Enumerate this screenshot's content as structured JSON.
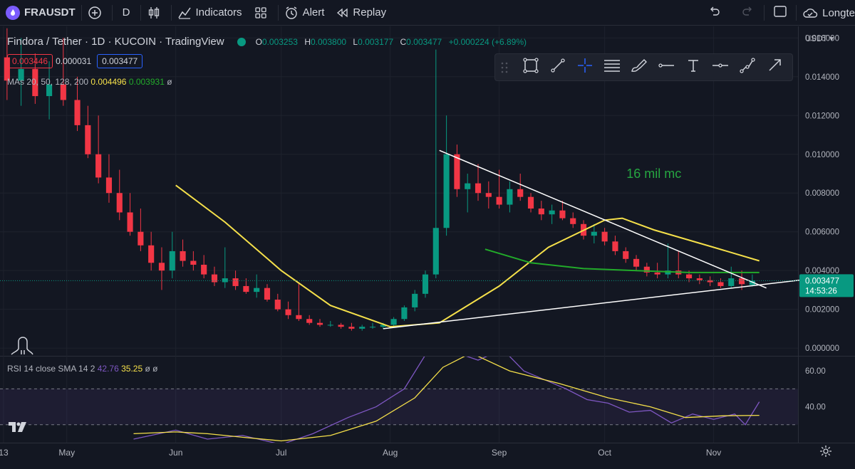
{
  "toolbar": {
    "symbol": "FRAUSDT",
    "interval": "D",
    "indicators_label": "Indicators",
    "alert_label": "Alert",
    "replay_label": "Replay",
    "long_label": "Longte"
  },
  "legend": {
    "title": "Findora / Tether · 1D · KUCOIN · TradingView",
    "o_label": "O",
    "o": "0.003253",
    "h_label": "H",
    "h": "0.003800",
    "l_label": "L",
    "l": "0.003177",
    "c_label": "C",
    "c": "0.003477",
    "change": "+0.000224 (+6.89%)",
    "bid": "0.003446",
    "spread": "0.000031",
    "ask": "0.003477",
    "mas_label": "MAs 20, 50, 128, 200",
    "ma_val_1": "0.004496",
    "ma_val_2": "0.003931",
    "mas_null": "ø"
  },
  "rsi_legend": {
    "label": "RSI 14 close SMA 14 2",
    "rsi": "42.76",
    "sma": "35.25",
    "nulls": "ø ø"
  },
  "colors": {
    "up": "#089981",
    "down": "#f23645",
    "ma_yellow": "#f5e04a",
    "ma_green": "#22ab2a",
    "rsi": "#7e57c2",
    "rsi_sma": "#f5e04a",
    "annotation": "#26a641"
  },
  "icons": [
    "fire-icon",
    "plus-circle-icon",
    "candles-icon",
    "indicators-icon",
    "templates-icon",
    "alarm-icon",
    "replay-icon",
    "undo-icon",
    "redo-icon",
    "layout-icon",
    "cloud-icon",
    "gear-icon"
  ],
  "chart_data": {
    "type": "candlestick",
    "title": "Findora / Tether · 1D · KUCOIN · TradingView",
    "price_axis": {
      "unit": "USDT",
      "ylim": [
        -0.0004,
        0.0166
      ],
      "ticks": [
        "0.000000",
        "0.002000",
        "0.004000",
        "0.006000",
        "0.008000",
        "0.010000",
        "0.012000",
        "0.014000",
        "0.016000"
      ],
      "last_price": "0.003477",
      "countdown": "14:53:26"
    },
    "time_axis": {
      "ticks": [
        "13",
        "May",
        "Jun",
        "Jul",
        "Aug",
        "Sep",
        "Oct",
        "Nov"
      ],
      "tick_dates": [
        "2022-04-13",
        "2022-05-01",
        "2022-06-01",
        "2022-07-01",
        "2022-08-01",
        "2022-09-01",
        "2022-10-01",
        "2022-11-01"
      ],
      "range": [
        "2022-04-12",
        "2022-11-25"
      ]
    },
    "candles": [
      {
        "d": "2022-04-14",
        "o": 0.015,
        "h": 0.0165,
        "l": 0.0128,
        "c": 0.0138
      },
      {
        "d": "2022-04-18",
        "o": 0.0138,
        "h": 0.016,
        "l": 0.0125,
        "c": 0.0144
      },
      {
        "d": "2022-04-22",
        "o": 0.0144,
        "h": 0.0152,
        "l": 0.0126,
        "c": 0.013
      },
      {
        "d": "2022-04-26",
        "o": 0.013,
        "h": 0.0148,
        "l": 0.0118,
        "c": 0.0136
      },
      {
        "d": "2022-04-30",
        "o": 0.0136,
        "h": 0.016,
        "l": 0.0125,
        "c": 0.0128
      },
      {
        "d": "2022-05-04",
        "o": 0.0128,
        "h": 0.014,
        "l": 0.0112,
        "c": 0.0115
      },
      {
        "d": "2022-05-07",
        "o": 0.0115,
        "h": 0.0125,
        "l": 0.0098,
        "c": 0.01
      },
      {
        "d": "2022-05-10",
        "o": 0.01,
        "h": 0.012,
        "l": 0.0085,
        "c": 0.0088
      },
      {
        "d": "2022-05-13",
        "o": 0.0088,
        "h": 0.01,
        "l": 0.0075,
        "c": 0.008
      },
      {
        "d": "2022-05-16",
        "o": 0.008,
        "h": 0.0092,
        "l": 0.0066,
        "c": 0.007
      },
      {
        "d": "2022-05-19",
        "o": 0.007,
        "h": 0.008,
        "l": 0.0058,
        "c": 0.006
      },
      {
        "d": "2022-05-22",
        "o": 0.006,
        "h": 0.0072,
        "l": 0.005,
        "c": 0.0053
      },
      {
        "d": "2022-05-25",
        "o": 0.0053,
        "h": 0.006,
        "l": 0.004,
        "c": 0.0044
      },
      {
        "d": "2022-05-28",
        "o": 0.0044,
        "h": 0.0052,
        "l": 0.003,
        "c": 0.004
      },
      {
        "d": "2022-05-31",
        "o": 0.004,
        "h": 0.006,
        "l": 0.0036,
        "c": 0.005
      },
      {
        "d": "2022-06-03",
        "o": 0.005,
        "h": 0.0056,
        "l": 0.0042,
        "c": 0.0045
      },
      {
        "d": "2022-06-06",
        "o": 0.0045,
        "h": 0.005,
        "l": 0.004,
        "c": 0.0043
      },
      {
        "d": "2022-06-09",
        "o": 0.0043,
        "h": 0.0048,
        "l": 0.0036,
        "c": 0.0038
      },
      {
        "d": "2022-06-12",
        "o": 0.0038,
        "h": 0.0042,
        "l": 0.0032,
        "c": 0.0034
      },
      {
        "d": "2022-06-15",
        "o": 0.0034,
        "h": 0.0052,
        "l": 0.0031,
        "c": 0.0036
      },
      {
        "d": "2022-06-18",
        "o": 0.0036,
        "h": 0.004,
        "l": 0.003,
        "c": 0.0032
      },
      {
        "d": "2022-06-21",
        "o": 0.0032,
        "h": 0.0036,
        "l": 0.0028,
        "c": 0.0029
      },
      {
        "d": "2022-06-24",
        "o": 0.0029,
        "h": 0.0038,
        "l": 0.0026,
        "c": 0.0031
      },
      {
        "d": "2022-06-27",
        "o": 0.0031,
        "h": 0.0033,
        "l": 0.0024,
        "c": 0.0025
      },
      {
        "d": "2022-06-30",
        "o": 0.0025,
        "h": 0.0028,
        "l": 0.0019,
        "c": 0.002
      },
      {
        "d": "2022-07-03",
        "o": 0.002,
        "h": 0.0024,
        "l": 0.0015,
        "c": 0.0017
      },
      {
        "d": "2022-07-06",
        "o": 0.0017,
        "h": 0.0034,
        "l": 0.0014,
        "c": 0.0015
      },
      {
        "d": "2022-07-09",
        "o": 0.0015,
        "h": 0.0017,
        "l": 0.0012,
        "c": 0.0013
      },
      {
        "d": "2022-07-12",
        "o": 0.0013,
        "h": 0.0015,
        "l": 0.0011,
        "c": 0.0012
      },
      {
        "d": "2022-07-15",
        "o": 0.0012,
        "h": 0.0014,
        "l": 0.0011,
        "c": 0.0012
      },
      {
        "d": "2022-07-18",
        "o": 0.0012,
        "h": 0.0013,
        "l": 0.001,
        "c": 0.0011
      },
      {
        "d": "2022-07-21",
        "o": 0.0011,
        "h": 0.0013,
        "l": 0.0009,
        "c": 0.001
      },
      {
        "d": "2022-07-24",
        "o": 0.001,
        "h": 0.0012,
        "l": 0.0009,
        "c": 0.0011
      },
      {
        "d": "2022-07-27",
        "o": 0.0011,
        "h": 0.0013,
        "l": 0.001,
        "c": 0.0011
      },
      {
        "d": "2022-07-30",
        "o": 0.0011,
        "h": 0.0013,
        "l": 0.001,
        "c": 0.0012
      },
      {
        "d": "2022-08-02",
        "o": 0.0012,
        "h": 0.0016,
        "l": 0.0011,
        "c": 0.0015
      },
      {
        "d": "2022-08-05",
        "o": 0.0015,
        "h": 0.0022,
        "l": 0.0014,
        "c": 0.0021
      },
      {
        "d": "2022-08-08",
        "o": 0.0021,
        "h": 0.003,
        "l": 0.0019,
        "c": 0.0028
      },
      {
        "d": "2022-08-11",
        "o": 0.0028,
        "h": 0.004,
        "l": 0.0026,
        "c": 0.0038
      },
      {
        "d": "2022-08-14",
        "o": 0.0038,
        "h": 0.0154,
        "l": 0.0036,
        "c": 0.0062
      },
      {
        "d": "2022-08-17",
        "o": 0.0062,
        "h": 0.012,
        "l": 0.0058,
        "c": 0.01
      },
      {
        "d": "2022-08-20",
        "o": 0.01,
        "h": 0.0105,
        "l": 0.0078,
        "c": 0.0082
      },
      {
        "d": "2022-08-23",
        "o": 0.0082,
        "h": 0.009,
        "l": 0.007,
        "c": 0.0085
      },
      {
        "d": "2022-08-26",
        "o": 0.0085,
        "h": 0.0095,
        "l": 0.0076,
        "c": 0.008
      },
      {
        "d": "2022-08-29",
        "o": 0.008,
        "h": 0.0086,
        "l": 0.0072,
        "c": 0.0078
      },
      {
        "d": "2022-09-01",
        "o": 0.0078,
        "h": 0.0092,
        "l": 0.0072,
        "c": 0.0074
      },
      {
        "d": "2022-09-04",
        "o": 0.0074,
        "h": 0.0086,
        "l": 0.007,
        "c": 0.0082
      },
      {
        "d": "2022-09-07",
        "o": 0.0082,
        "h": 0.009,
        "l": 0.0076,
        "c": 0.0078
      },
      {
        "d": "2022-09-10",
        "o": 0.0078,
        "h": 0.008,
        "l": 0.007,
        "c": 0.0072
      },
      {
        "d": "2022-09-13",
        "o": 0.0072,
        "h": 0.0076,
        "l": 0.0066,
        "c": 0.0069
      },
      {
        "d": "2022-09-16",
        "o": 0.0069,
        "h": 0.0074,
        "l": 0.0064,
        "c": 0.0071
      },
      {
        "d": "2022-09-19",
        "o": 0.0071,
        "h": 0.0076,
        "l": 0.0066,
        "c": 0.0067
      },
      {
        "d": "2022-09-22",
        "o": 0.0067,
        "h": 0.007,
        "l": 0.0062,
        "c": 0.0064
      },
      {
        "d": "2022-09-25",
        "o": 0.0064,
        "h": 0.0066,
        "l": 0.0056,
        "c": 0.0058
      },
      {
        "d": "2022-09-28",
        "o": 0.0058,
        "h": 0.0064,
        "l": 0.0054,
        "c": 0.006
      },
      {
        "d": "2022-10-01",
        "o": 0.006,
        "h": 0.0062,
        "l": 0.0053,
        "c": 0.0055
      },
      {
        "d": "2022-10-04",
        "o": 0.0055,
        "h": 0.0058,
        "l": 0.0048,
        "c": 0.005
      },
      {
        "d": "2022-10-07",
        "o": 0.005,
        "h": 0.0052,
        "l": 0.0044,
        "c": 0.0046
      },
      {
        "d": "2022-10-10",
        "o": 0.0046,
        "h": 0.0048,
        "l": 0.004,
        "c": 0.0042
      },
      {
        "d": "2022-10-13",
        "o": 0.0042,
        "h": 0.0044,
        "l": 0.0037,
        "c": 0.0039
      },
      {
        "d": "2022-10-16",
        "o": 0.0039,
        "h": 0.0044,
        "l": 0.0036,
        "c": 0.0038
      },
      {
        "d": "2022-10-19",
        "o": 0.0038,
        "h": 0.0054,
        "l": 0.0036,
        "c": 0.004
      },
      {
        "d": "2022-10-22",
        "o": 0.004,
        "h": 0.005,
        "l": 0.0036,
        "c": 0.0038
      },
      {
        "d": "2022-10-25",
        "o": 0.0038,
        "h": 0.004,
        "l": 0.0034,
        "c": 0.0036
      },
      {
        "d": "2022-10-28",
        "o": 0.0036,
        "h": 0.0038,
        "l": 0.0033,
        "c": 0.0035
      },
      {
        "d": "2022-10-31",
        "o": 0.0035,
        "h": 0.0037,
        "l": 0.0032,
        "c": 0.0034
      },
      {
        "d": "2022-11-03",
        "o": 0.0034,
        "h": 0.0036,
        "l": 0.0031,
        "c": 0.0032
      },
      {
        "d": "2022-11-06",
        "o": 0.0032,
        "h": 0.0042,
        "l": 0.0031,
        "c": 0.0036
      },
      {
        "d": "2022-11-09",
        "o": 0.0036,
        "h": 0.004,
        "l": 0.003,
        "c": 0.0033
      },
      {
        "d": "2022-11-12",
        "o": 0.003253,
        "h": 0.0038,
        "l": 0.003177,
        "c": 0.003477
      }
    ],
    "moving_averages": [
      {
        "color": "#f5e04a",
        "last": 0.004496,
        "points": [
          [
            "2022-06-01",
            0.0084
          ],
          [
            "2022-06-15",
            0.0065
          ],
          [
            "2022-07-01",
            0.004
          ],
          [
            "2022-07-15",
            0.0022
          ],
          [
            "2022-08-01",
            0.0011
          ],
          [
            "2022-08-15",
            0.0013
          ],
          [
            "2022-09-01",
            0.0032
          ],
          [
            "2022-09-15",
            0.0052
          ],
          [
            "2022-10-01",
            0.0066
          ],
          [
            "2022-10-06",
            0.0067
          ],
          [
            "2022-10-15",
            0.0061
          ],
          [
            "2022-11-01",
            0.0052
          ],
          [
            "2022-11-14",
            0.0045
          ]
        ]
      },
      {
        "color": "#22ab2a",
        "last": 0.003931,
        "points": [
          [
            "2022-08-28",
            0.0051
          ],
          [
            "2022-09-10",
            0.0044
          ],
          [
            "2022-09-25",
            0.0041
          ],
          [
            "2022-10-10",
            0.004
          ],
          [
            "2022-10-25",
            0.0039
          ],
          [
            "2022-11-14",
            0.0039
          ]
        ]
      }
    ],
    "trendlines": [
      {
        "from": [
          "2022-08-15",
          0.0102
        ],
        "to": [
          "2022-11-16",
          0.0031
        ]
      },
      {
        "from": [
          "2022-07-30",
          0.001
        ],
        "to": [
          "2022-11-30",
          0.0036
        ]
      }
    ],
    "annotation": {
      "text": "16 mil mc",
      "d": "2022-10-15",
      "y": 0.009
    },
    "rsi": {
      "ylim": [
        20,
        68
      ],
      "ticks": [
        "40.00",
        "60.00"
      ],
      "bands": [
        30,
        50
      ],
      "rsi_points": [
        [
          "2022-05-20",
          22
        ],
        [
          "2022-06-01",
          27
        ],
        [
          "2022-06-10",
          22
        ],
        [
          "2022-06-20",
          24
        ],
        [
          "2022-07-01",
          19
        ],
        [
          "2022-07-10",
          25
        ],
        [
          "2022-07-20",
          34
        ],
        [
          "2022-07-28",
          40
        ],
        [
          "2022-08-05",
          50
        ],
        [
          "2022-08-12",
          72
        ],
        [
          "2022-08-16",
          85
        ],
        [
          "2022-08-20",
          70
        ],
        [
          "2022-08-26",
          66
        ],
        [
          "2022-09-02",
          72
        ],
        [
          "2022-09-08",
          60
        ],
        [
          "2022-09-14",
          55
        ],
        [
          "2022-09-20",
          50
        ],
        [
          "2022-09-26",
          44
        ],
        [
          "2022-10-02",
          42
        ],
        [
          "2022-10-08",
          37
        ],
        [
          "2022-10-14",
          38
        ],
        [
          "2022-10-20",
          31
        ],
        [
          "2022-10-26",
          36
        ],
        [
          "2022-11-01",
          33
        ],
        [
          "2022-11-07",
          36
        ],
        [
          "2022-11-10",
          30
        ],
        [
          "2022-11-14",
          42.76
        ]
      ],
      "sma_points": [
        [
          "2022-05-20",
          25
        ],
        [
          "2022-06-01",
          26
        ],
        [
          "2022-06-10",
          25
        ],
        [
          "2022-06-20",
          23
        ],
        [
          "2022-07-01",
          21
        ],
        [
          "2022-07-15",
          24
        ],
        [
          "2022-07-28",
          32
        ],
        [
          "2022-08-08",
          45
        ],
        [
          "2022-08-16",
          62
        ],
        [
          "2022-08-24",
          70
        ],
        [
          "2022-09-04",
          60
        ],
        [
          "2022-09-18",
          53
        ],
        [
          "2022-10-02",
          45
        ],
        [
          "2022-10-14",
          40
        ],
        [
          "2022-10-24",
          34
        ],
        [
          "2022-11-04",
          35
        ],
        [
          "2022-11-14",
          35.25
        ]
      ]
    }
  }
}
